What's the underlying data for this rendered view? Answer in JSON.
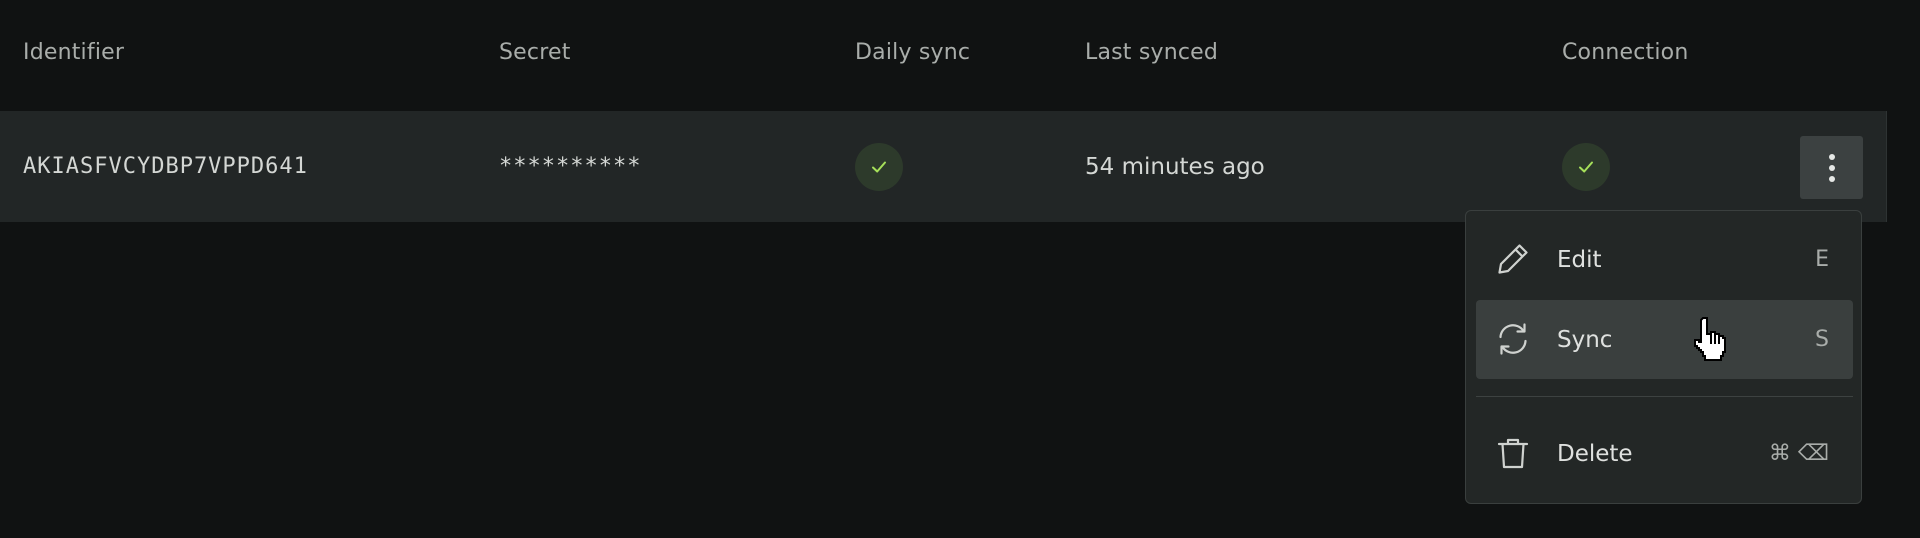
{
  "table": {
    "headers": {
      "identifier": "Identifier",
      "secret": "Secret",
      "daily_sync": "Daily sync",
      "last_synced": "Last synced",
      "connection": "Connection"
    },
    "rows": [
      {
        "identifier": "AKIASFVCYDBP7VPPD641",
        "secret": "**********",
        "daily_sync": "check-icon",
        "last_synced": "54 minutes ago",
        "connection": "check-icon"
      }
    ]
  },
  "row_menu": {
    "trigger_icon": "more-vertical-icon",
    "items": [
      {
        "label": "Edit",
        "shortcut": "E",
        "icon": "pencil-icon"
      },
      {
        "label": "Sync",
        "shortcut": "S",
        "icon": "refresh-icon"
      },
      {
        "label": "Delete",
        "shortcut": "⌘ ⌫",
        "icon": "trash-icon"
      }
    ]
  },
  "colors": {
    "background": "#101212",
    "row_background": "#222626",
    "menu_background": "#232726",
    "menu_hover": "#3a3f3e",
    "success_green": "#a6e05a",
    "badge_background": "#2d3a2b"
  }
}
